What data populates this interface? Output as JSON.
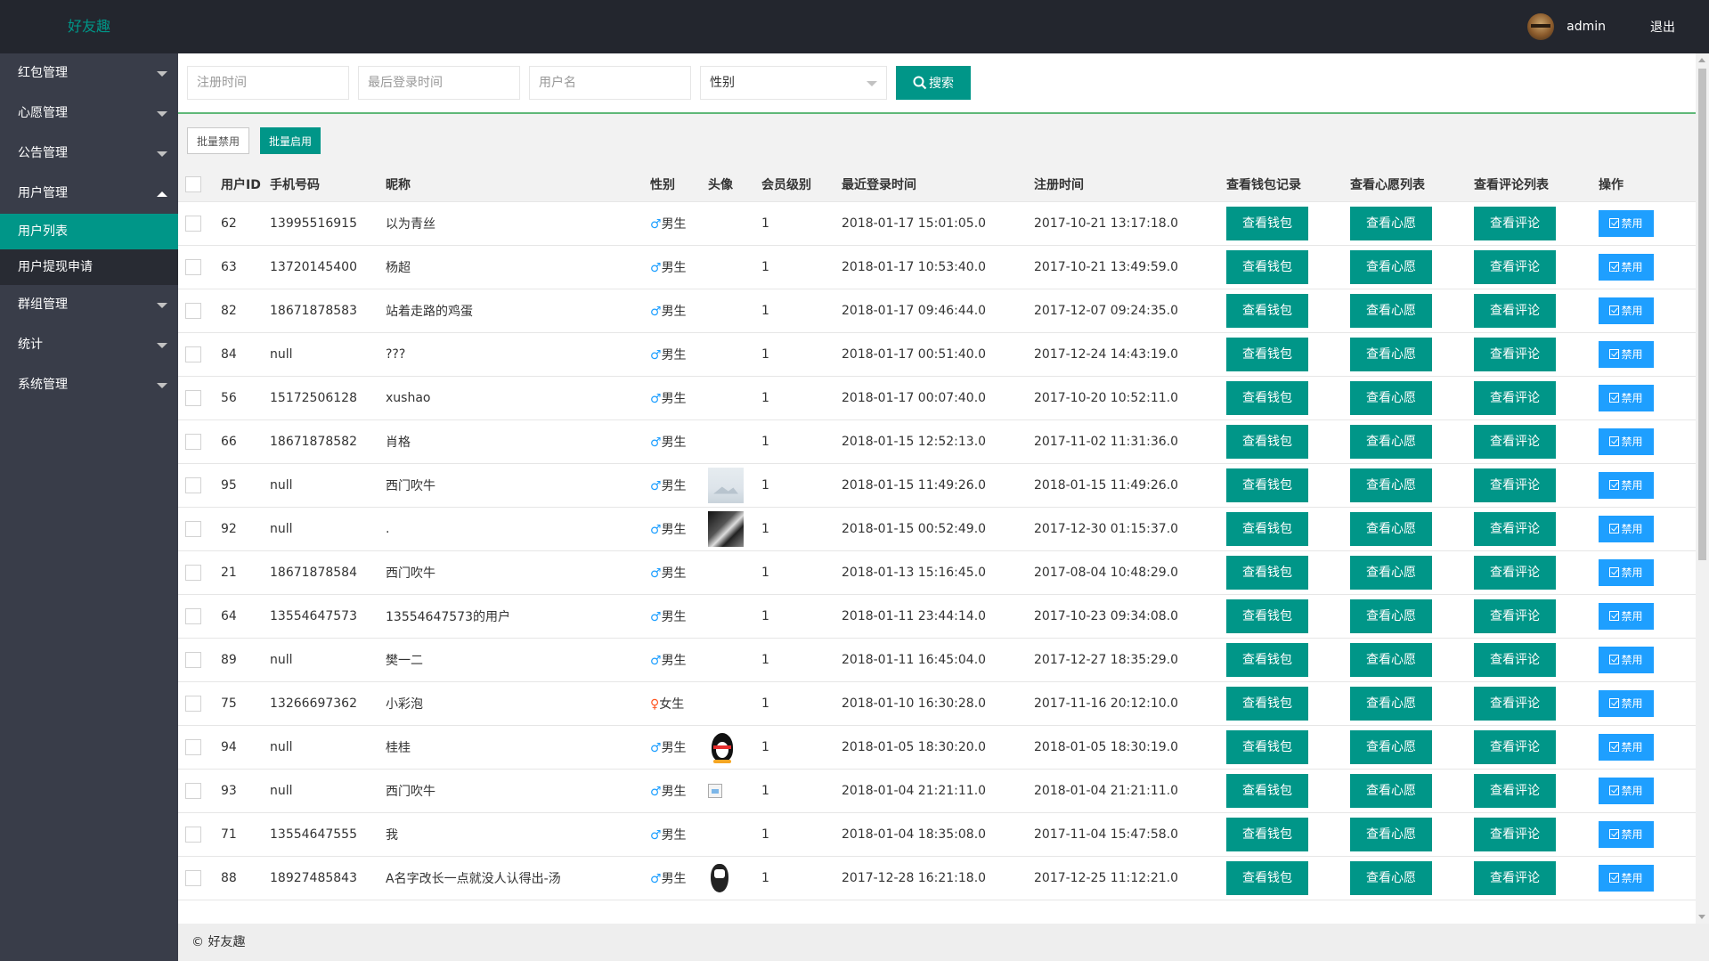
{
  "header": {
    "logo": "好友趣",
    "user": "admin",
    "logout": "退出"
  },
  "sidebar": {
    "items": [
      {
        "label": "红包管理",
        "expanded": false
      },
      {
        "label": "心愿管理",
        "expanded": false
      },
      {
        "label": "公告管理",
        "expanded": false
      },
      {
        "label": "用户管理",
        "expanded": true
      },
      {
        "label": "群组管理",
        "expanded": false
      },
      {
        "label": "统计",
        "expanded": false
      },
      {
        "label": "系统管理",
        "expanded": false
      }
    ],
    "sub_items": [
      {
        "label": "用户列表",
        "active": true
      },
      {
        "label": "用户提现申请",
        "active": false
      }
    ]
  },
  "search": {
    "register_time_placeholder": "注册时间",
    "last_login_placeholder": "最后登录时间",
    "username_placeholder": "用户名",
    "gender_select": "性别",
    "search_button": "搜索"
  },
  "batch": {
    "disable": "批量禁用",
    "enable": "批量启用"
  },
  "table": {
    "headers": {
      "id": "用户ID",
      "phone": "手机号码",
      "nickname": "昵称",
      "gender": "性别",
      "avatar": "头像",
      "level": "会员级别",
      "last_login": "最近登录时间",
      "register": "注册时间",
      "wallet": "查看钱包记录",
      "wish": "查看心愿列表",
      "comment": "查看评论列表",
      "op": "操作"
    },
    "buttons": {
      "wallet": "查看钱包",
      "wish": "查看心愿",
      "comment": "查看评论",
      "ban": "禁用"
    },
    "rows": [
      {
        "id": "62",
        "phone": "13995516915",
        "nickname": "以为青丝",
        "gender": "男生",
        "avatar": "",
        "level": "1",
        "last_login": "2018-01-17 15:01:05.0",
        "register": "2017-10-21 13:17:18.0"
      },
      {
        "id": "63",
        "phone": "13720145400",
        "nickname": "杨超",
        "gender": "男生",
        "avatar": "",
        "level": "1",
        "last_login": "2018-01-17 10:53:40.0",
        "register": "2017-10-21 13:49:59.0"
      },
      {
        "id": "82",
        "phone": "18671878583",
        "nickname": "站着走路的鸡蛋",
        "gender": "男生",
        "avatar": "",
        "level": "1",
        "last_login": "2018-01-17 09:46:44.0",
        "register": "2017-12-07 09:24:35.0"
      },
      {
        "id": "84",
        "phone": "null",
        "nickname": "???",
        "gender": "男生",
        "avatar": "",
        "level": "1",
        "last_login": "2018-01-17 00:51:40.0",
        "register": "2017-12-24 14:43:19.0"
      },
      {
        "id": "56",
        "phone": "15172506128",
        "nickname": "xushao",
        "gender": "男生",
        "avatar": "",
        "level": "1",
        "last_login": "2018-01-17 00:07:40.0",
        "register": "2017-10-20 10:52:11.0"
      },
      {
        "id": "66",
        "phone": "18671878582",
        "nickname": "肖格",
        "gender": "男生",
        "avatar": "",
        "level": "1",
        "last_login": "2018-01-15 12:52:13.0",
        "register": "2017-11-02 11:31:36.0"
      },
      {
        "id": "95",
        "phone": "null",
        "nickname": "西门吹牛",
        "gender": "男生",
        "avatar": "landscape",
        "level": "1",
        "last_login": "2018-01-15 11:49:26.0",
        "register": "2018-01-15 11:49:26.0"
      },
      {
        "id": "92",
        "phone": "null",
        "nickname": ".",
        "gender": "男生",
        "avatar": "photo",
        "level": "1",
        "last_login": "2018-01-15 00:52:49.0",
        "register": "2017-12-30 01:15:37.0"
      },
      {
        "id": "21",
        "phone": "18671878584",
        "nickname": "西门吹牛",
        "gender": "男生",
        "avatar": "",
        "level": "1",
        "last_login": "2018-01-13 15:16:45.0",
        "register": "2017-08-04 10:48:29.0"
      },
      {
        "id": "64",
        "phone": "13554647573",
        "nickname": "13554647573的用户",
        "gender": "男生",
        "avatar": "",
        "level": "1",
        "last_login": "2018-01-11 23:44:14.0",
        "register": "2017-10-23 09:34:08.0"
      },
      {
        "id": "89",
        "phone": "null",
        "nickname": "樊一二",
        "gender": "男生",
        "avatar": "",
        "level": "1",
        "last_login": "2018-01-11 16:45:04.0",
        "register": "2017-12-27 18:35:29.0"
      },
      {
        "id": "75",
        "phone": "13266697362",
        "nickname": "小彩泡",
        "gender": "女生",
        "avatar": "",
        "level": "1",
        "last_login": "2018-01-10 16:30:28.0",
        "register": "2017-11-16 20:12:10.0"
      },
      {
        "id": "94",
        "phone": "null",
        "nickname": "桂桂",
        "gender": "男生",
        "avatar": "penguin",
        "level": "1",
        "last_login": "2018-01-05 18:30:20.0",
        "register": "2018-01-05 18:30:19.0"
      },
      {
        "id": "93",
        "phone": "null",
        "nickname": "西门吹牛",
        "gender": "男生",
        "avatar": "broken",
        "level": "1",
        "last_login": "2018-01-04 21:21:11.0",
        "register": "2018-01-04 21:21:11.0"
      },
      {
        "id": "71",
        "phone": "13554647555",
        "nickname": "我",
        "gender": "男生",
        "avatar": "",
        "level": "1",
        "last_login": "2018-01-04 18:35:08.0",
        "register": "2017-11-04 15:47:58.0"
      },
      {
        "id": "88",
        "phone": "18927485843",
        "nickname": "A名字改长一点就没人认得出-汤",
        "gender": "男生",
        "avatar": "beard",
        "level": "1",
        "last_login": "2017-12-28 16:21:18.0",
        "register": "2017-12-25 11:12:21.0"
      }
    ]
  },
  "footer": {
    "text": "© 好友趣"
  },
  "colors": {
    "accent": "#009688",
    "header": "#23262e",
    "sidebar": "#393d49",
    "ban": "#1e9fff"
  }
}
